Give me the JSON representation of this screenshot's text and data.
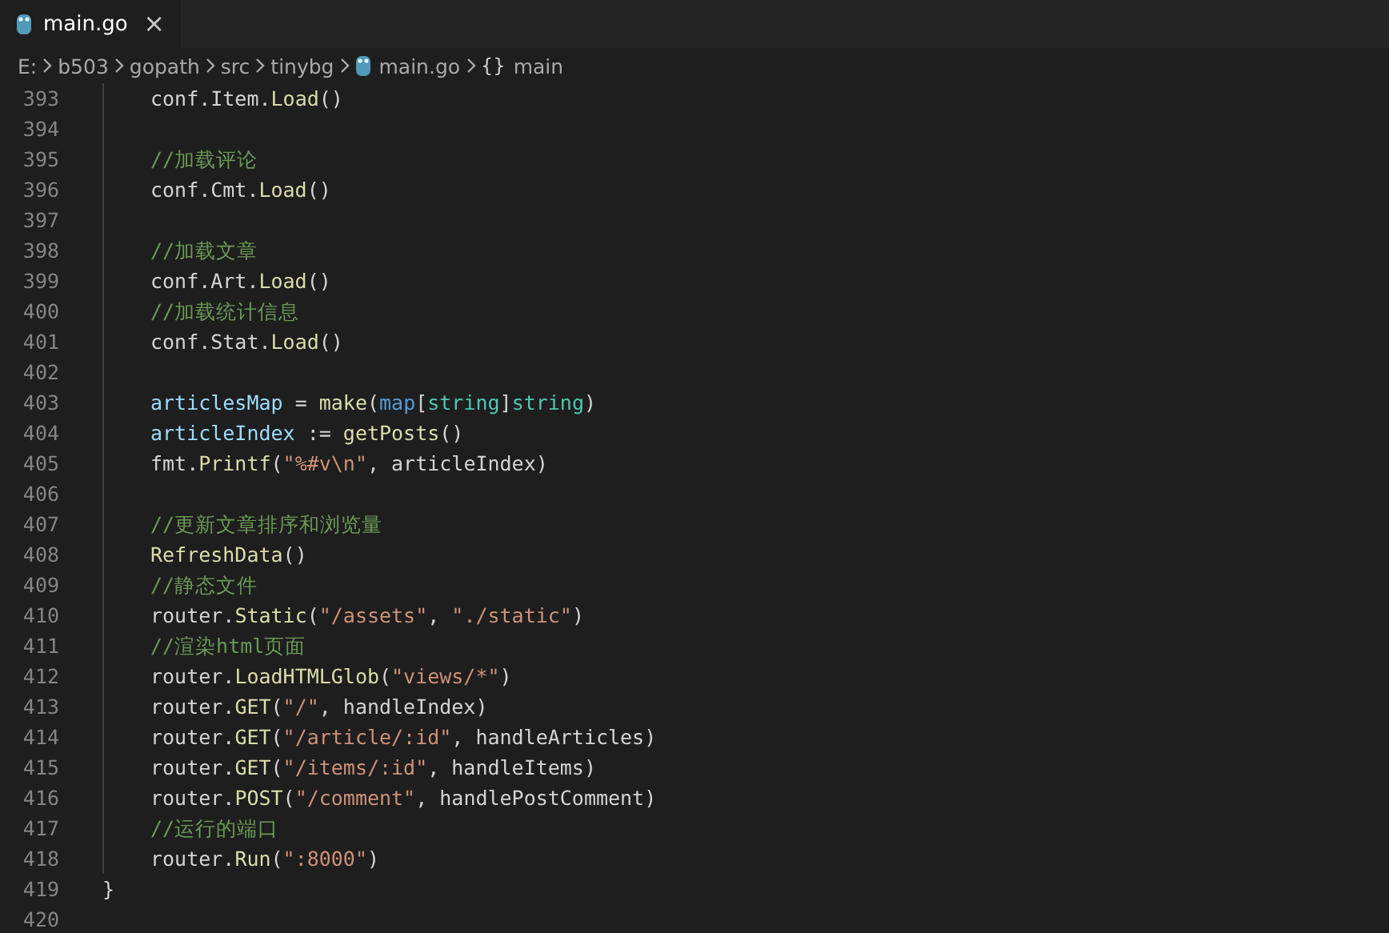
{
  "tabs": [
    {
      "label": "main.go",
      "selected": true,
      "close": "×"
    }
  ],
  "breadcrumb": [
    {
      "kind": "text",
      "label": "E:"
    },
    {
      "kind": "text",
      "label": "b503"
    },
    {
      "kind": "text",
      "label": "gopath"
    },
    {
      "kind": "text",
      "label": "src"
    },
    {
      "kind": "text",
      "label": "tinybg"
    },
    {
      "kind": "file",
      "label": "main.go"
    },
    {
      "kind": "symbol",
      "icon": "{}",
      "label": "main"
    }
  ],
  "lines": [
    {
      "number": "393",
      "indent": true,
      "tokens": [
        {
          "kind": "plain",
          "text": "conf.Item."
        },
        {
          "kind": "func",
          "text": "Load"
        },
        {
          "kind": "plain",
          "text": "()"
        }
      ]
    },
    {
      "number": "394",
      "indent": true
    },
    {
      "number": "395",
      "indent": true,
      "tokens": [
        {
          "kind": "comment",
          "text": "//加载评论"
        }
      ]
    },
    {
      "number": "396",
      "indent": true,
      "tokens": [
        {
          "kind": "plain",
          "text": "conf.Cmt."
        },
        {
          "kind": "func",
          "text": "Load"
        },
        {
          "kind": "plain",
          "text": "()"
        }
      ]
    },
    {
      "number": "397",
      "indent": true
    },
    {
      "number": "398",
      "indent": true,
      "tokens": [
        {
          "kind": "comment",
          "text": "//加载文章"
        }
      ]
    },
    {
      "number": "399",
      "indent": true,
      "tokens": [
        {
          "kind": "plain",
          "text": "conf.Art."
        },
        {
          "kind": "func",
          "text": "Load"
        },
        {
          "kind": "plain",
          "text": "()"
        }
      ]
    },
    {
      "number": "400",
      "indent": true,
      "tokens": [
        {
          "kind": "comment",
          "text": "//加载统计信息"
        }
      ]
    },
    {
      "number": "401",
      "indent": true,
      "tokens": [
        {
          "kind": "plain",
          "text": "conf.Stat."
        },
        {
          "kind": "func",
          "text": "Load"
        },
        {
          "kind": "plain",
          "text": "()"
        }
      ]
    },
    {
      "number": "402",
      "indent": true
    },
    {
      "number": "403",
      "indent": true,
      "tokens": [
        {
          "kind": "var",
          "text": "articlesMap"
        },
        {
          "kind": "plain",
          "text": " = "
        },
        {
          "kind": "func",
          "text": "make"
        },
        {
          "kind": "plain",
          "text": "("
        },
        {
          "kind": "keyword",
          "text": "map"
        },
        {
          "kind": "plain",
          "text": "["
        },
        {
          "kind": "type",
          "text": "string"
        },
        {
          "kind": "plain",
          "text": "]"
        },
        {
          "kind": "type",
          "text": "string"
        },
        {
          "kind": "plain",
          "text": ")"
        }
      ]
    },
    {
      "number": "404",
      "indent": true,
      "tokens": [
        {
          "kind": "var",
          "text": "articleIndex"
        },
        {
          "kind": "plain",
          "text": " := "
        },
        {
          "kind": "func",
          "text": "getPosts"
        },
        {
          "kind": "plain",
          "text": "()"
        }
      ]
    },
    {
      "number": "405",
      "indent": true,
      "tokens": [
        {
          "kind": "plain",
          "text": "fmt."
        },
        {
          "kind": "func",
          "text": "Printf"
        },
        {
          "kind": "plain",
          "text": "("
        },
        {
          "kind": "string",
          "text": "\"%#v\\n\""
        },
        {
          "kind": "plain",
          "text": ", articleIndex)"
        }
      ]
    },
    {
      "number": "406",
      "indent": true
    },
    {
      "number": "407",
      "indent": true,
      "tokens": [
        {
          "kind": "comment",
          "text": "//更新文章排序和浏览量"
        }
      ]
    },
    {
      "number": "408",
      "indent": true,
      "tokens": [
        {
          "kind": "func",
          "text": "RefreshData"
        },
        {
          "kind": "plain",
          "text": "()"
        }
      ]
    },
    {
      "number": "409",
      "indent": true,
      "tokens": [
        {
          "kind": "comment",
          "text": "//静态文件"
        }
      ]
    },
    {
      "number": "410",
      "indent": true,
      "tokens": [
        {
          "kind": "plain",
          "text": "router."
        },
        {
          "kind": "func",
          "text": "Static"
        },
        {
          "kind": "plain",
          "text": "("
        },
        {
          "kind": "string",
          "text": "\"/assets\""
        },
        {
          "kind": "plain",
          "text": ", "
        },
        {
          "kind": "string",
          "text": "\"./static\""
        },
        {
          "kind": "plain",
          "text": ")"
        }
      ]
    },
    {
      "number": "411",
      "indent": true,
      "tokens": [
        {
          "kind": "comment",
          "text": "//渲染html页面"
        }
      ]
    },
    {
      "number": "412",
      "indent": true,
      "tokens": [
        {
          "kind": "plain",
          "text": "router."
        },
        {
          "kind": "func",
          "text": "LoadHTMLGlob"
        },
        {
          "kind": "plain",
          "text": "("
        },
        {
          "kind": "string",
          "text": "\"views/*\""
        },
        {
          "kind": "plain",
          "text": ")"
        }
      ]
    },
    {
      "number": "413",
      "indent": true,
      "tokens": [
        {
          "kind": "plain",
          "text": "router."
        },
        {
          "kind": "func",
          "text": "GET"
        },
        {
          "kind": "plain",
          "text": "("
        },
        {
          "kind": "string",
          "text": "\"/\""
        },
        {
          "kind": "plain",
          "text": ", handleIndex)"
        }
      ]
    },
    {
      "number": "414",
      "indent": true,
      "tokens": [
        {
          "kind": "plain",
          "text": "router."
        },
        {
          "kind": "func",
          "text": "GET"
        },
        {
          "kind": "plain",
          "text": "("
        },
        {
          "kind": "string",
          "text": "\"/article/:id\""
        },
        {
          "kind": "plain",
          "text": ", handleArticles)"
        }
      ]
    },
    {
      "number": "415",
      "indent": true,
      "tokens": [
        {
          "kind": "plain",
          "text": "router."
        },
        {
          "kind": "func",
          "text": "GET"
        },
        {
          "kind": "plain",
          "text": "("
        },
        {
          "kind": "string",
          "text": "\"/items/:id\""
        },
        {
          "kind": "plain",
          "text": ", handleItems)"
        }
      ]
    },
    {
      "number": "416",
      "indent": true,
      "tokens": [
        {
          "kind": "plain",
          "text": "router."
        },
        {
          "kind": "func",
          "text": "POST"
        },
        {
          "kind": "plain",
          "text": "("
        },
        {
          "kind": "string",
          "text": "\"/comment\""
        },
        {
          "kind": "plain",
          "text": ", handlePostComment)"
        }
      ]
    },
    {
      "number": "417",
      "indent": true,
      "tokens": [
        {
          "kind": "comment",
          "text": "//运行的端口"
        }
      ]
    },
    {
      "number": "418",
      "indent": true,
      "tokens": [
        {
          "kind": "plain",
          "text": "router."
        },
        {
          "kind": "func",
          "text": "Run"
        },
        {
          "kind": "plain",
          "text": "("
        },
        {
          "kind": "string",
          "text": "\":8000\""
        },
        {
          "kind": "plain",
          "text": ")"
        }
      ]
    },
    {
      "number": "419",
      "indent": false,
      "tokens": [
        {
          "kind": "plain",
          "text": "}"
        }
      ]
    },
    {
      "number": "420",
      "indent": false
    }
  ]
}
